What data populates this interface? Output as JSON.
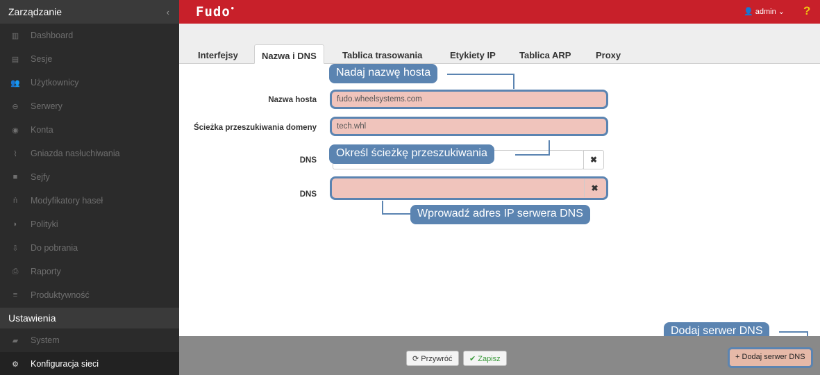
{
  "sidebar": {
    "header": "Zarządzanie",
    "collapse": "‹",
    "items": [
      {
        "icon": "▥",
        "label": "Dashboard"
      },
      {
        "icon": "▤",
        "label": "Sesje"
      },
      {
        "icon": "👥",
        "label": "Użytkownicy"
      },
      {
        "icon": "⊖",
        "label": "Serwery"
      },
      {
        "icon": "◉",
        "label": "Konta"
      },
      {
        "icon": "⌇",
        "label": "Gniazda nasłuchiwania"
      },
      {
        "icon": "■",
        "label": "Sejfy"
      },
      {
        "icon": "ṅ",
        "label": "Modyfikatory haseł"
      },
      {
        "icon": "◗",
        "label": "Polityki"
      },
      {
        "icon": "⇩",
        "label": "Do pobrania"
      },
      {
        "icon": "⎙",
        "label": "Raporty"
      },
      {
        "icon": "≡",
        "label": "Produktywność"
      }
    ],
    "section2": "Ustawienia",
    "items2": [
      {
        "icon": "▰",
        "label": "System"
      },
      {
        "icon": "⚙",
        "label": "Konfiguracja sieci"
      }
    ]
  },
  "topbar": {
    "logo": "Fudo",
    "user": "admin",
    "user_icon": "👤",
    "help": "?"
  },
  "tabs": [
    "Interfejsy",
    "Nazwa i DNS",
    "Tablica trasowania",
    "Etykiety IP",
    "Tablica ARP",
    "Proxy"
  ],
  "form": {
    "hostname_label": "Nazwa hosta",
    "hostname_value": "fudo.wheelsystems.com",
    "search_label": "Ścieżka przeszukiwania domeny",
    "search_value": "tech.whl",
    "dns_label": "DNS",
    "dns1_value": "",
    "dns2_value": "",
    "remove_glyph": "✖"
  },
  "callouts": {
    "hostname": "Nadaj nazwę hosta",
    "search": "Określ ścieżkę przeszukiwania",
    "dns": "Wprowadź adres IP serwera DNS",
    "add_dns": "Dodaj serwer DNS"
  },
  "footer": {
    "restore": "Przywróć",
    "restore_icon": "⟳",
    "save": "Zapisz",
    "save_icon": "✔",
    "add_dns": "Dodaj serwer DNS",
    "add_icon": "+"
  },
  "colors": {
    "topbar": "#c8202a",
    "callout": "#5b84b1",
    "highlight": "#f0c4bc"
  }
}
